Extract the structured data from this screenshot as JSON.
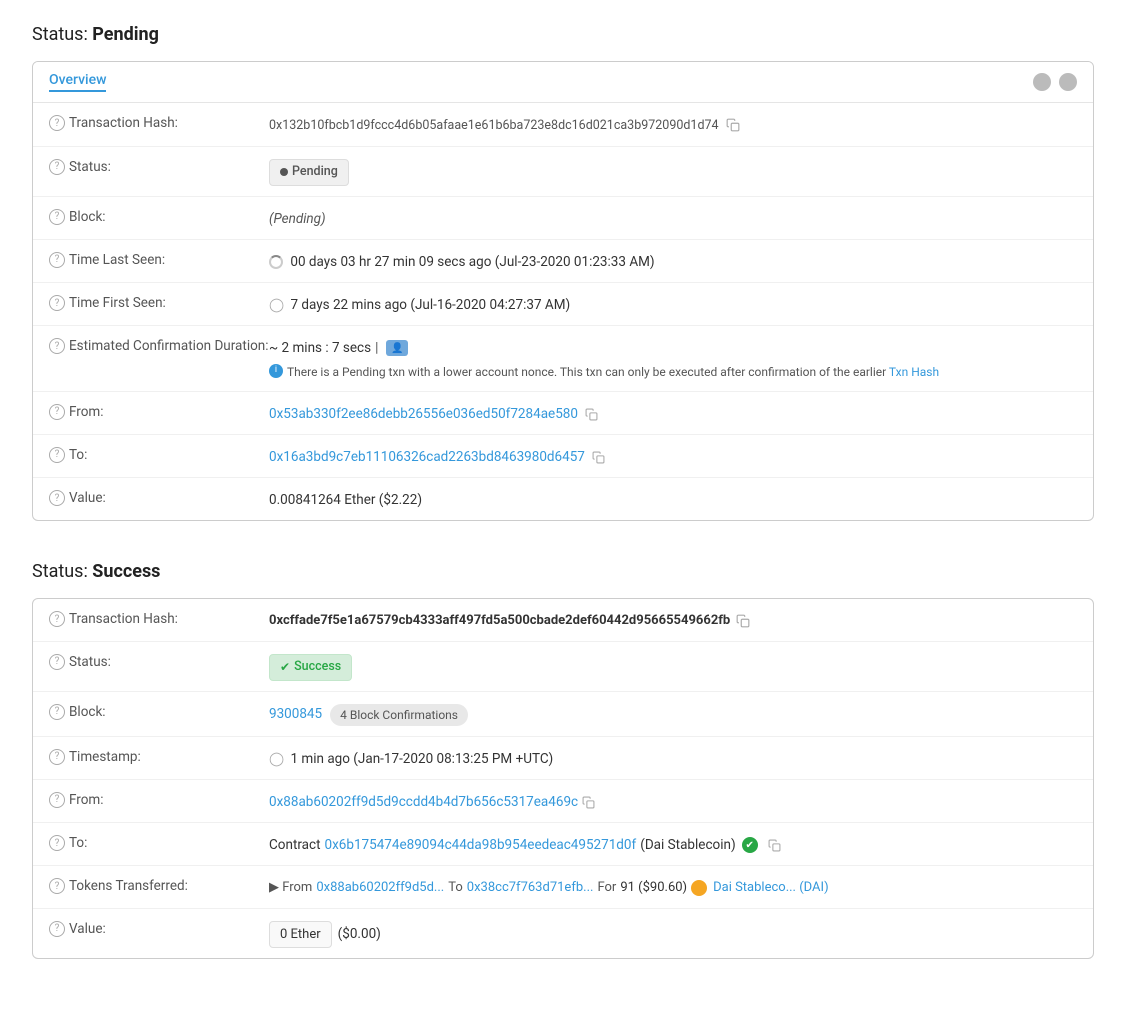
{
  "pending_section": {
    "title": "Status:",
    "title_bold": "Pending",
    "tab": {
      "label": "Overview",
      "icons": [
        "circle1",
        "circle2"
      ]
    },
    "rows": {
      "transaction_hash": {
        "label": "Transaction Hash:",
        "value": "0x132b10fbcb1d9fccc4d6b05afaae1e61b6ba723e8dc16d021ca3b972090d1d74"
      },
      "status": {
        "label": "Status:",
        "badge": "Pending"
      },
      "block": {
        "label": "Block:",
        "value": "(Pending)"
      },
      "time_last_seen": {
        "label": "Time Last Seen:",
        "value": "00 days 03 hr 27 min 09 secs ago (Jul-23-2020 01:23:33 AM)"
      },
      "time_first_seen": {
        "label": "Time First Seen:",
        "value": "7 days 22 mins ago (Jul-16-2020 04:27:37 AM)"
      },
      "estimated_confirmation": {
        "label": "Estimated Confirmation Duration:",
        "value": "~ 2 mins : 7 secs",
        "note": "There is a Pending txn with a lower account nonce. This txn can only be executed after confirmation of the earlier Txn Hash"
      },
      "from": {
        "label": "From:",
        "value": "0x53ab330f2ee86debb26556e036ed50f7284ae580"
      },
      "to": {
        "label": "To:",
        "value": "0x16a3bd9c7eb11106326cad2263bd8463980d6457"
      },
      "value": {
        "label": "Value:",
        "value": "0.00841264 Ether ($2.22)"
      }
    }
  },
  "success_section": {
    "title": "Status:",
    "title_bold": "Success",
    "rows": {
      "transaction_hash": {
        "label": "Transaction Hash:",
        "value": "0xcffade7f5e1a67579cb4333aff497fd5a500cbade2def60442d95665549662fb"
      },
      "status": {
        "label": "Status:",
        "badge": "Success"
      },
      "block": {
        "label": "Block:",
        "value": "9300845",
        "confirmations": "4 Block Confirmations"
      },
      "timestamp": {
        "label": "Timestamp:",
        "value": "1 min ago (Jan-17-2020 08:13:25 PM +UTC)"
      },
      "from": {
        "label": "From:",
        "value": "0x88ab60202ff9d5d9ccdd4b4d7b656c5317ea469c"
      },
      "to": {
        "label": "To:",
        "contract_prefix": "Contract",
        "contract_address": "0x6b175474e89094c44da98b954eedeac495271d0f",
        "contract_name": "(Dai Stablecoin)"
      },
      "tokens_transferred": {
        "label": "Tokens Transferred:",
        "from_prefix": "▶ From",
        "from_address": "0x88ab60202ff9d5d...",
        "to_prefix": "To",
        "to_address": "0x38cc7f763d71efb...",
        "for_prefix": "For",
        "amount": "91 ($90.60)",
        "token_name": "Dai Stableco... (DAI)"
      },
      "value": {
        "label": "Value:",
        "box_value": "0 Ether",
        "usd_value": "($0.00)"
      }
    }
  }
}
